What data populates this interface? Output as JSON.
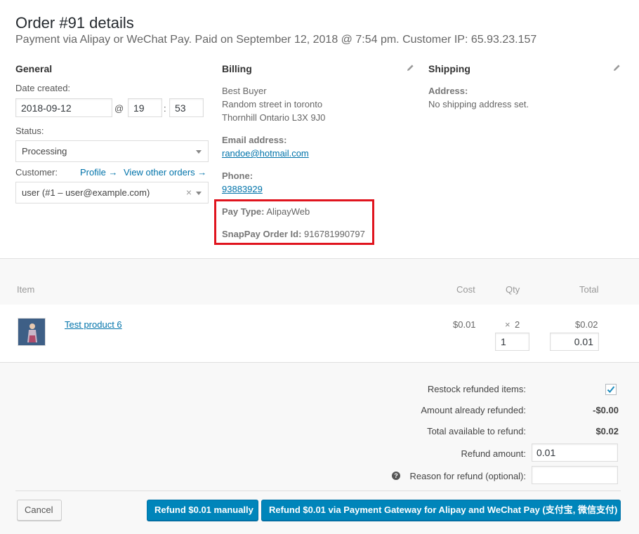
{
  "header": {
    "title": "Order #91 details",
    "subtitle": "Payment via Alipay or WeChat Pay. Paid on September 12, 2018 @ 7:54 pm. Customer IP: 65.93.23.157"
  },
  "general": {
    "heading": "General",
    "date_label": "Date created:",
    "date_value": "2018-09-12",
    "at": "@",
    "hour_value": "19",
    "colon": ":",
    "minute_value": "53",
    "status_label": "Status:",
    "status_value": "Processing",
    "customer_label": "Customer:",
    "profile_link": "Profile →",
    "other_orders_link": "View other orders →",
    "customer_value": "user (#1 – user@example.com)",
    "clear_symbol": "×"
  },
  "billing": {
    "heading": "Billing",
    "address_line1": "Best Buyer",
    "address_line2": "Random street in toronto",
    "address_line3": "Thornhill Ontario L3X 9J0",
    "email_label": "Email address:",
    "email_value": "randoe@hotmail.com",
    "phone_label": "Phone:",
    "phone_value": "93883929",
    "pay_type_label": "Pay Type:",
    "pay_type_value": "AlipayWeb",
    "order_id_label": "SnapPay Order Id:",
    "order_id_value": "916781990797"
  },
  "shipping": {
    "heading": "Shipping",
    "address_label": "Address:",
    "address_value": "No shipping address set."
  },
  "items": {
    "headers": {
      "item": "Item",
      "cost": "Cost",
      "qty": "Qty",
      "total": "Total"
    },
    "rows": [
      {
        "name": "Test product 6",
        "cost": "$0.01",
        "qty_prefix": "×",
        "qty": "2",
        "qty_refund": "1",
        "total": "$0.02",
        "total_refund": "0.01"
      }
    ]
  },
  "refund": {
    "restock_label": "Restock refunded items:",
    "restock_checked": true,
    "already_refunded_label": "Amount already refunded:",
    "already_refunded_value": "-$0.00",
    "available_label": "Total available to refund:",
    "available_value": "$0.02",
    "amount_label": "Refund amount:",
    "amount_value": "0.01",
    "reason_label": "Reason for refund (optional):",
    "reason_value": "",
    "help_icon": "?"
  },
  "actions": {
    "cancel_label": "Cancel",
    "manual_label": "Refund $0.01 manually",
    "gateway_label": "Refund $0.01 via Payment Gateway for Alipay and WeChat Pay (支付宝, 微信支付)"
  },
  "colors": {
    "primary": "#0085ba",
    "link": "#0073aa",
    "highlight": "#e0141e"
  }
}
